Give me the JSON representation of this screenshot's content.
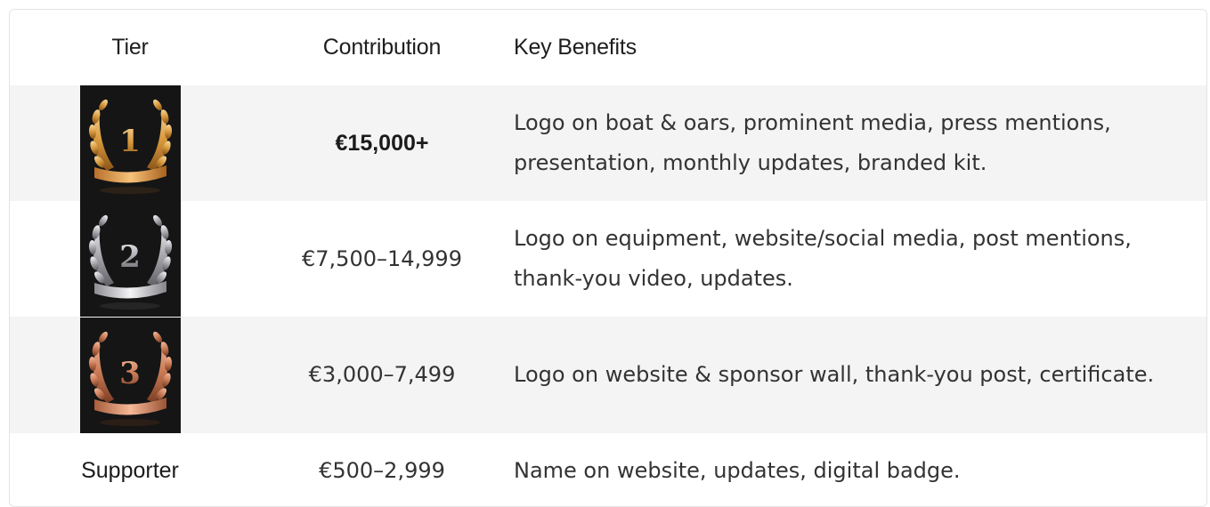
{
  "table": {
    "headers": {
      "tier": "Tier",
      "contribution": "Contribution",
      "benefits": "Key Benefits"
    },
    "rows": [
      {
        "tier_icon": "gold-medal-1-icon",
        "medal_number": "1",
        "contribution": "€15,000+",
        "benefits": "Logo on boat & oars, prominent media, press mentions, presentation, monthly updates, branded kit."
      },
      {
        "tier_icon": "silver-medal-2-icon",
        "medal_number": "2",
        "contribution": "€7,500–14,999",
        "benefits": "Logo on equipment, website/social media, post mentions, thank-you video, updates."
      },
      {
        "tier_icon": "bronze-medal-3-icon",
        "medal_number": "3",
        "contribution": "€3,000–7,499",
        "benefits": "Logo on website & sponsor wall, thank-you post, certificate."
      },
      {
        "tier": "Supporter",
        "contribution": "€500–2,999",
        "benefits": "Name on website, updates, digital badge."
      }
    ]
  },
  "colors": {
    "gold": "#e0a040",
    "silver": "#c8c8cc",
    "bronze": "#d08a6a",
    "row_shade": "#f4f4f4",
    "medal_bg": "#151515"
  }
}
